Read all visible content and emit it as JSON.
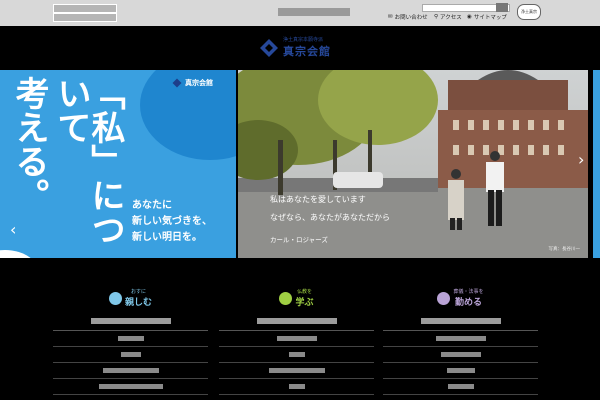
{
  "colors": {
    "accent_blue": "#3aa0e0",
    "dark_blue": "#1f86cf",
    "logo_blue": "#26489a",
    "col1": "#7fc7e8",
    "col2": "#9fcf43",
    "col3": "#b9a3d6"
  },
  "topbar": {
    "nav": [
      {
        "label": "お問い合わせ",
        "icon": "mail-icon"
      },
      {
        "label": "アクセス",
        "icon": "location-pin-icon"
      },
      {
        "label": "サイトマップ",
        "icon": "sitemap-icon"
      }
    ],
    "badge": "浄土真宗"
  },
  "logo": {
    "small": "浄土真宗本願寺派",
    "main": "真宗会館"
  },
  "hero_left": {
    "headline_line1": "「私」について",
    "headline_line2": "考える。",
    "copy_line1": "あなたに",
    "copy_line2": "新しい気づきを、",
    "copy_line3": "新しい明日を。",
    "logo_text": "真宗会館"
  },
  "hero_main": {
    "quote_line1": "私はあなたを愛しています",
    "quote_line2": "なぜなら、あなたがあなただから",
    "author": "カール・ロジャーズ",
    "credit": "写真：長谷川一"
  },
  "columns": [
    {
      "small": "おすに",
      "big": "親しむ",
      "items": 4
    },
    {
      "small": "仏教を",
      "big": "学ぶ",
      "items": 4
    },
    {
      "small": "葬儀・法事を",
      "big": "勤める",
      "items": 4
    }
  ]
}
